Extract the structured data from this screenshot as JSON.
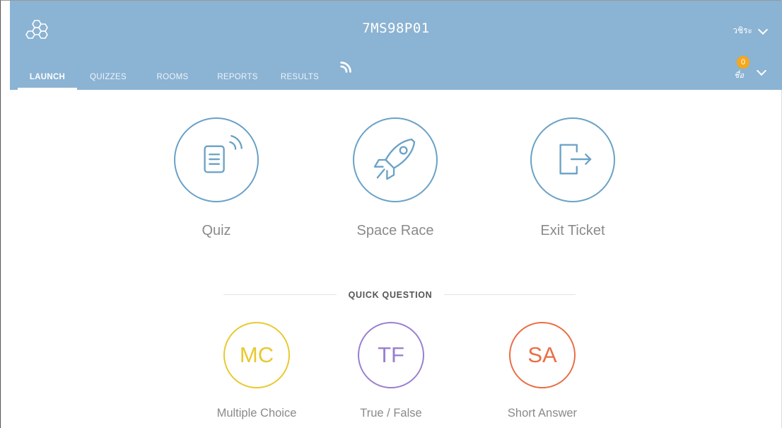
{
  "header": {
    "room_code": "7MS98P01",
    "user_name": "วชิระ",
    "notifications": {
      "count": "0",
      "label": "ชื่อ"
    }
  },
  "tabs": [
    {
      "label": "LAUNCH",
      "active": true
    },
    {
      "label": "QUIZZES"
    },
    {
      "label": "ROOMS"
    },
    {
      "label": "REPORTS"
    },
    {
      "label": "RESULTS"
    }
  ],
  "launch_options": [
    {
      "label": "Quiz",
      "icon": "quiz-icon"
    },
    {
      "label": "Space Race",
      "icon": "rocket-icon"
    },
    {
      "label": "Exit Ticket",
      "icon": "exit-icon"
    }
  ],
  "quick_question": {
    "title": "QUICK QUESTION",
    "items": [
      {
        "abbr": "MC",
        "label": "Multiple Choice",
        "color": "#e8c930"
      },
      {
        "abbr": "TF",
        "label": "True / False",
        "color": "#9a7fcf"
      },
      {
        "abbr": "SA",
        "label": "Short Answer",
        "color": "#ea6d45"
      }
    ]
  },
  "colors": {
    "header_bg": "#8bb3d3",
    "icon_stroke": "#6aa1c6"
  }
}
